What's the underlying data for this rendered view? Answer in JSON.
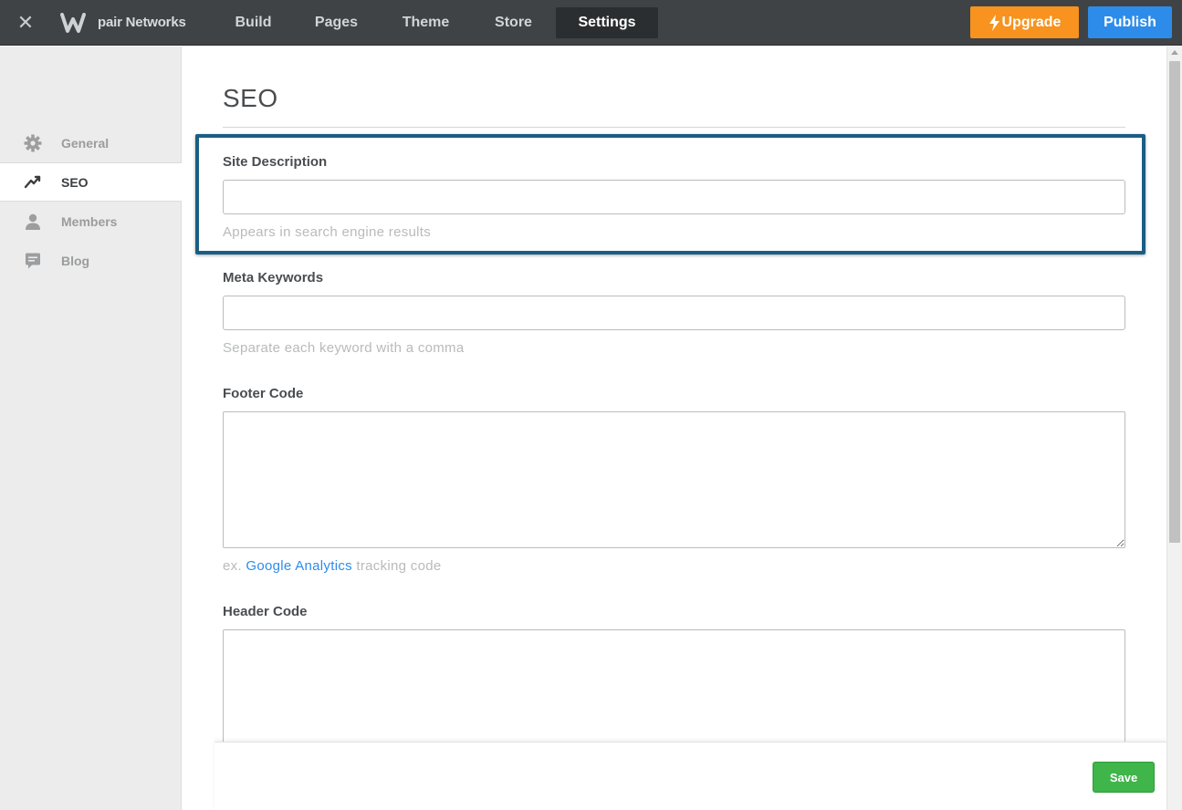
{
  "topbar": {
    "close_icon": "close-icon",
    "logo_icon": "weebly-w-logo",
    "brand": "pair Networks",
    "nav": [
      {
        "label": "Build",
        "active": false
      },
      {
        "label": "Pages",
        "active": false
      },
      {
        "label": "Theme",
        "active": false
      },
      {
        "label": "Store",
        "active": false
      },
      {
        "label": "Settings",
        "active": true
      }
    ],
    "upgrade_label": "Upgrade",
    "publish_label": "Publish",
    "colors": {
      "bar": "#3f4346",
      "upgrade": "#f7931e",
      "publish": "#2d8cea"
    }
  },
  "sidebar": {
    "items": [
      {
        "label": "General",
        "icon": "gear-icon",
        "active": false
      },
      {
        "label": "SEO",
        "icon": "trend-line-icon",
        "active": true
      },
      {
        "label": "Members",
        "icon": "user-icon",
        "active": false
      },
      {
        "label": "Blog",
        "icon": "comment-icon",
        "active": false
      }
    ]
  },
  "main": {
    "title": "SEO",
    "fields": {
      "site_description": {
        "label": "Site Description",
        "value": "",
        "help": "Appears in search engine results"
      },
      "meta_keywords": {
        "label": "Meta Keywords",
        "value": "",
        "help": "Separate each keyword with a comma"
      },
      "footer_code": {
        "label": "Footer Code",
        "value": "",
        "help_prefix": "ex.",
        "help_link": "Google Analytics",
        "help_suffix": "tracking code"
      },
      "header_code": {
        "label": "Header Code",
        "value": ""
      }
    },
    "highlight_color": "#1a5e85"
  },
  "footer": {
    "save_label": "Save",
    "save_color": "#3fb54a"
  }
}
